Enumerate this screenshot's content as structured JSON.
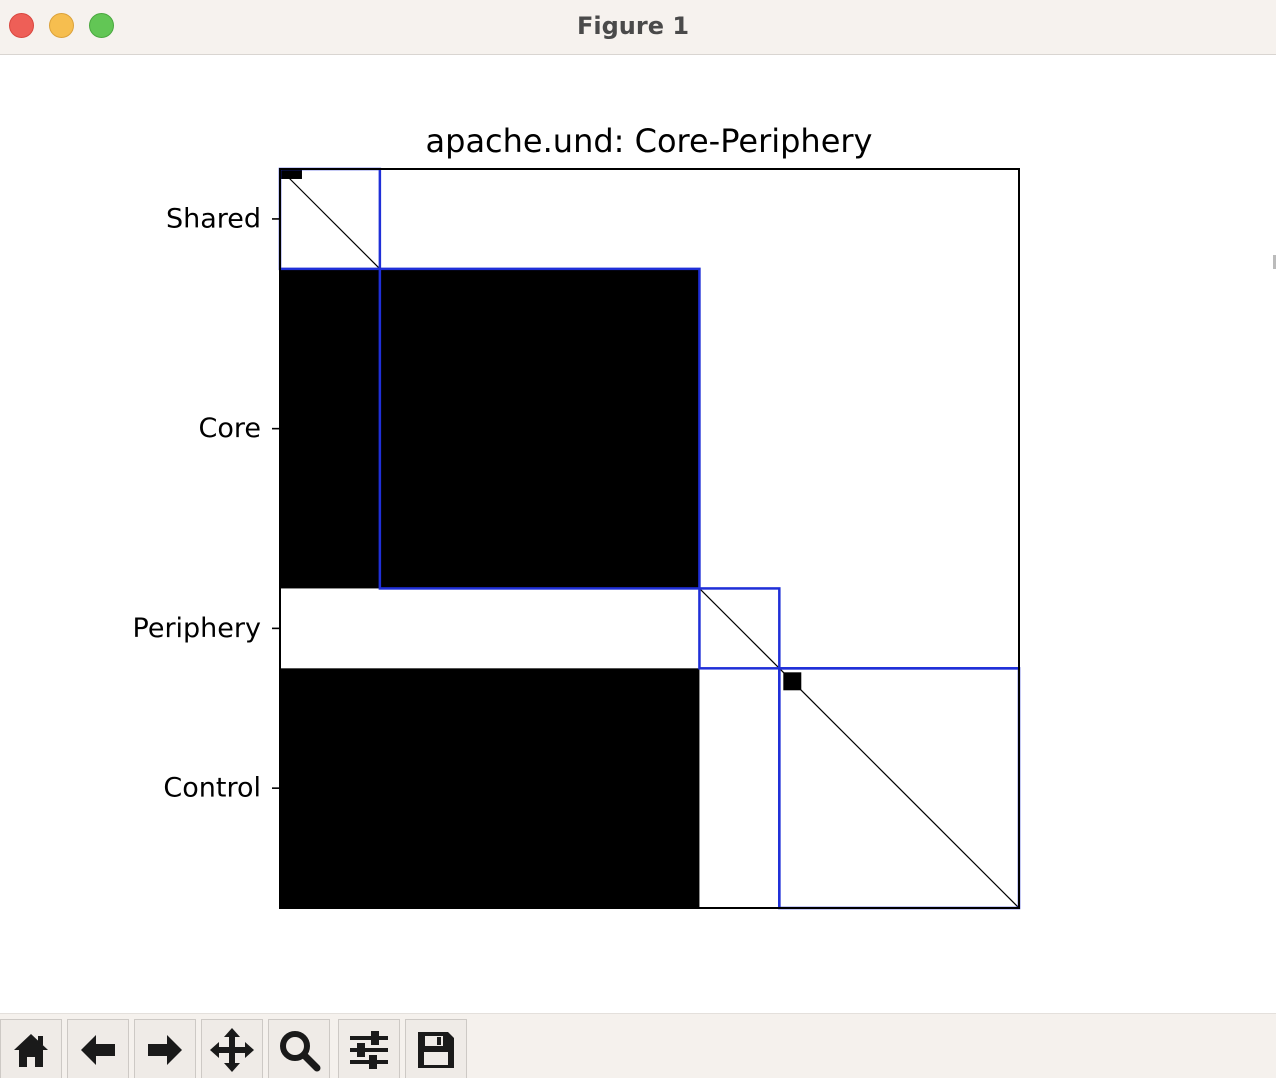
{
  "window": {
    "title": "Figure 1"
  },
  "toolbar": {
    "buttons": [
      {
        "name": "home-button",
        "icon": "home-icon"
      },
      {
        "name": "back-button",
        "icon": "arrow-left-icon"
      },
      {
        "name": "forward-button",
        "icon": "arrow-right-icon"
      },
      {
        "name": "pan-button",
        "icon": "move-icon"
      },
      {
        "name": "zoom-button",
        "icon": "magnifier-icon"
      },
      {
        "name": "configure-subplots-button",
        "icon": "sliders-icon"
      },
      {
        "name": "save-button",
        "icon": "floppy-disk-icon"
      }
    ]
  },
  "chart_data": {
    "type": "heatmap",
    "title": "apache.und: Core-Periphery",
    "colormap": "binary",
    "grid": false,
    "n_nodes": 370,
    "tick_labels": [
      "Shared",
      "Core",
      "Periphery",
      "Control"
    ],
    "tick_positions": [
      25,
      130,
      230,
      310
    ],
    "groups": [
      {
        "name": "Shared",
        "start": 0,
        "end": 50
      },
      {
        "name": "Core",
        "start": 50,
        "end": 210
      },
      {
        "name": "Periphery",
        "start": 210,
        "end": 250
      },
      {
        "name": "Control",
        "start": 250,
        "end": 370
      }
    ],
    "dense_blocks": [
      {
        "rows": [
          50,
          210
        ],
        "cols": [
          0,
          210
        ],
        "density": 1.0
      },
      {
        "rows": [
          250,
          370
        ],
        "cols": [
          0,
          210
        ],
        "density": 1.0
      },
      {
        "rows": [
          0,
          5
        ],
        "cols": [
          0,
          11
        ],
        "density": 1.0
      },
      {
        "rows": [
          252,
          261
        ],
        "cols": [
          252,
          261
        ],
        "density": 1.0
      }
    ],
    "diagonal": true,
    "highlight_boxes": [
      {
        "rows": [
          0,
          50
        ],
        "cols": [
          0,
          50
        ]
      },
      {
        "rows": [
          50,
          210
        ],
        "cols": [
          50,
          210
        ]
      },
      {
        "rows": [
          210,
          250
        ],
        "cols": [
          210,
          250
        ]
      },
      {
        "rows": [
          250,
          370
        ],
        "cols": [
          250,
          370
        ]
      }
    ],
    "highlight_color": "#1f2fd8"
  }
}
